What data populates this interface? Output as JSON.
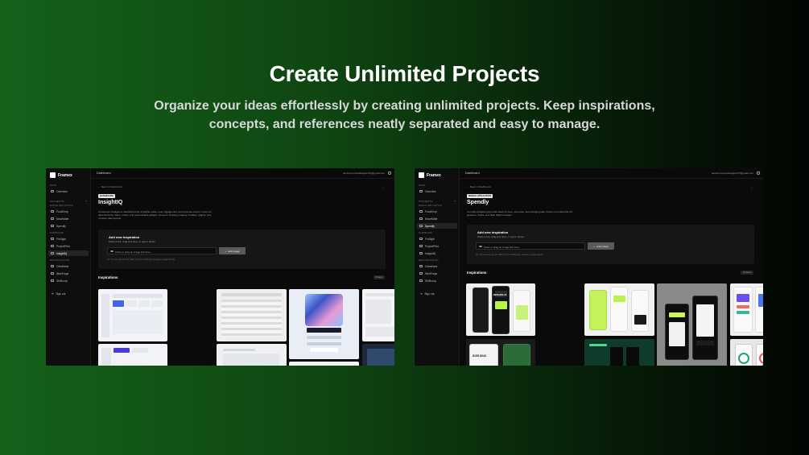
{
  "hero": {
    "title": "Create Unlimited Projects",
    "subtitle": "Organize your ideas effortlessly by creating unlimited projects. Keep inspirations, concepts, and references neatly separated and easy to manage."
  },
  "app": {
    "name": "Framex",
    "page_title": "Dashboard",
    "email": "iamanonymousdesigner07@gmail.com",
    "sidebar": {
      "main_label": "MAIN",
      "overview": "Overview",
      "projects_label": "PROJECTS",
      "groups": [
        {
          "label": "MOBILE APPLICATION",
          "items": [
            "FoodDrop",
            "MoveMate",
            "Spendly"
          ]
        },
        {
          "label": "DASHBOARD",
          "items": [
            "FinSight",
            "ProjectPilot",
            "InsightIQ"
          ]
        },
        {
          "label": "WEB APPLICATION",
          "items": [
            "ClientNest",
            "WebForge",
            "ShiftLoop"
          ]
        }
      ],
      "sign_out": "Sign out"
    },
    "back_label": "Back to Dashboard",
    "add_card": {
      "title": "Add new inspiration",
      "subtitle": "Paste a link, drag and drop, or type it below.",
      "input_placeholder": "Paste or drag an image link here...",
      "button": "Add Image",
      "tip": "Tip: You can also use ⌘V (Mac) or Ctrl+V (Windows) to paste an image directly"
    },
    "inspirations_label": "Inspirations"
  },
  "screens": {
    "left": {
      "badge": "DASHBOARD",
      "project_title": "InsightIQ",
      "description": "A business intelligence dashboard that visualizes sales, user engagement, and revenue metrics. Focus on data hierarchy, filters, charts, and customizable widgets. Great for showing mastery of tables, graphs, and complex data layouts.",
      "count": "8 items",
      "active_item": "InsightIQ"
    },
    "right": {
      "badge": "MOBILE APPLICATION",
      "project_title": "Spendly",
      "description": "A mobile budgeting app that tracks income, expenses, and savings goals. Focus on mobile-first UX, gestures, charts, and daily habit formation.",
      "count": "10 items",
      "active_item": "Spendly",
      "card_amounts": [
        "$209,891.21",
        "$155 8043"
      ]
    }
  },
  "colors": {
    "bg_start": "#15611a",
    "bg_end": "#020502",
    "app_bg": "#0a0a0a",
    "accent_green": "#b8f34a"
  }
}
